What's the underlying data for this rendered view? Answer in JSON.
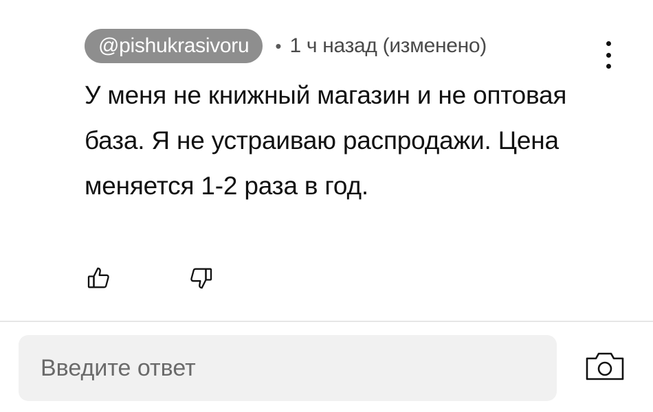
{
  "comment": {
    "author": "@pishukrasivoru",
    "separator": "•",
    "time": "1 ч назад (изменено)",
    "text": "У меня не книжный магазин и не оптовая база. Я не устраиваю распродажи. Цена меняется 1-2 раза в год."
  },
  "actions": {
    "like_icon": "thumbs-up-icon",
    "dislike_icon": "thumbs-down-icon",
    "more_icon": "more-vertical-icon"
  },
  "reply": {
    "placeholder": "Введите ответ",
    "value": "",
    "camera_icon": "camera-icon"
  },
  "colors": {
    "author_chip_bg": "#8e8e8e",
    "input_bg": "#f1f1f1",
    "divider": "#e6e6e6"
  }
}
